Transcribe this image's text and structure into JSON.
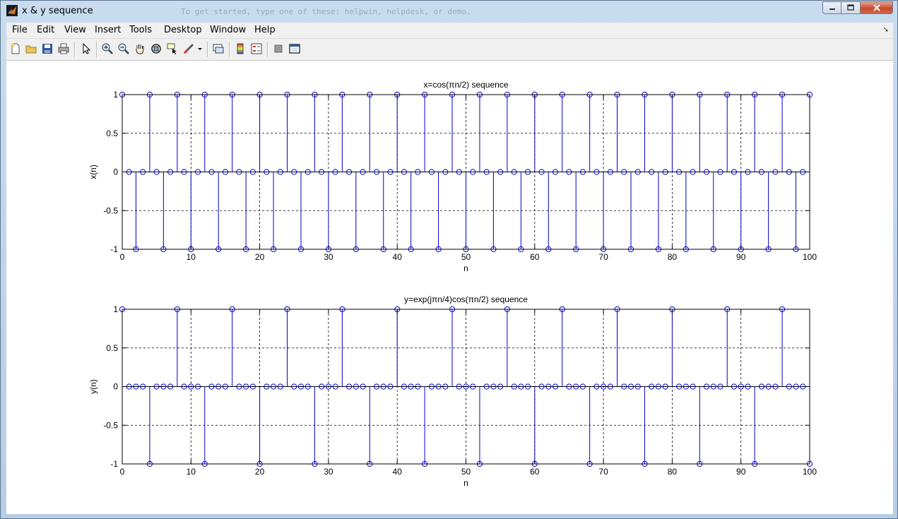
{
  "window": {
    "title": "x & y sequence",
    "command_hint": "To get started, type one of these: helpwin, helpdesk, or demo."
  },
  "menu": [
    "File",
    "Edit",
    "View",
    "Insert",
    "Tools",
    "Desktop",
    "Window",
    "Help"
  ],
  "toolbar_icons": [
    "new-figure-icon",
    "open-file-icon",
    "save-icon",
    "print-icon",
    "pointer-icon",
    "zoom-in-icon",
    "zoom-out-icon",
    "pan-icon",
    "rotate-3d-icon",
    "data-cursor-icon",
    "brush-icon",
    "brush-dropdown-icon",
    "link-plot-icon",
    "colorbar-icon",
    "legend-icon",
    "hide-plot-tools-icon",
    "show-plot-tools-icon"
  ],
  "colors": {
    "stem": "#0000cc",
    "axes": "#000000",
    "grid": "#000000"
  },
  "chart_data": [
    {
      "type": "stem",
      "title": "x=cos(πn/2) sequence",
      "xlabel": "n",
      "ylabel": "x(n)",
      "xlim": [
        0,
        100
      ],
      "ylim": [
        -1,
        1
      ],
      "xticks": [
        "0",
        "10",
        "20",
        "30",
        "40",
        "50",
        "60",
        "70",
        "80",
        "90",
        "100"
      ],
      "yticks": [
        "-1",
        "-0.5",
        "0",
        "0.5",
        "1"
      ],
      "grid": true,
      "n": [
        0,
        1,
        2,
        3,
        4,
        5,
        6,
        7,
        8,
        9,
        10,
        11,
        12,
        13,
        14,
        15,
        16,
        17,
        18,
        19,
        20,
        21,
        22,
        23,
        24,
        25,
        26,
        27,
        28,
        29,
        30,
        31,
        32,
        33,
        34,
        35,
        36,
        37,
        38,
        39,
        40,
        41,
        42,
        43,
        44,
        45,
        46,
        47,
        48,
        49,
        50,
        51,
        52,
        53,
        54,
        55,
        56,
        57,
        58,
        59,
        60,
        61,
        62,
        63,
        64,
        65,
        66,
        67,
        68,
        69,
        70,
        71,
        72,
        73,
        74,
        75,
        76,
        77,
        78,
        79,
        80,
        81,
        82,
        83,
        84,
        85,
        86,
        87,
        88,
        89,
        90,
        91,
        92,
        93,
        94,
        95,
        96,
        97,
        98,
        99,
        100
      ],
      "values": [
        1,
        0,
        -1,
        0,
        1,
        0,
        -1,
        0,
        1,
        0,
        -1,
        0,
        1,
        0,
        -1,
        0,
        1,
        0,
        -1,
        0,
        1,
        0,
        -1,
        0,
        1,
        0,
        -1,
        0,
        1,
        0,
        -1,
        0,
        1,
        0,
        -1,
        0,
        1,
        0,
        -1,
        0,
        1,
        0,
        -1,
        0,
        1,
        0,
        -1,
        0,
        1,
        0,
        -1,
        0,
        1,
        0,
        -1,
        0,
        1,
        0,
        -1,
        0,
        1,
        0,
        -1,
        0,
        1,
        0,
        -1,
        0,
        1,
        0,
        -1,
        0,
        1,
        0,
        -1,
        0,
        1,
        0,
        -1,
        0,
        1,
        0,
        -1,
        0,
        1,
        0,
        -1,
        0,
        1,
        0,
        -1,
        0,
        1,
        0,
        -1,
        0,
        1,
        0,
        -1,
        0,
        1
      ]
    },
    {
      "type": "stem",
      "title": "y=exp(jπn/4)cos(πn/2) sequence",
      "xlabel": "n",
      "ylabel": "y(n)",
      "xlim": [
        0,
        100
      ],
      "ylim": [
        -1,
        1
      ],
      "xticks": [
        "0",
        "10",
        "20",
        "30",
        "40",
        "50",
        "60",
        "70",
        "80",
        "90",
        "100"
      ],
      "yticks": [
        "-1",
        "-0.5",
        "0",
        "0.5",
        "1"
      ],
      "grid": true,
      "n": [
        0,
        1,
        2,
        3,
        4,
        5,
        6,
        7,
        8,
        9,
        10,
        11,
        12,
        13,
        14,
        15,
        16,
        17,
        18,
        19,
        20,
        21,
        22,
        23,
        24,
        25,
        26,
        27,
        28,
        29,
        30,
        31,
        32,
        33,
        34,
        35,
        36,
        37,
        38,
        39,
        40,
        41,
        42,
        43,
        44,
        45,
        46,
        47,
        48,
        49,
        50,
        51,
        52,
        53,
        54,
        55,
        56,
        57,
        58,
        59,
        60,
        61,
        62,
        63,
        64,
        65,
        66,
        67,
        68,
        69,
        70,
        71,
        72,
        73,
        74,
        75,
        76,
        77,
        78,
        79,
        80,
        81,
        82,
        83,
        84,
        85,
        86,
        87,
        88,
        89,
        90,
        91,
        92,
        93,
        94,
        95,
        96,
        97,
        98,
        99,
        100
      ],
      "values": [
        1,
        0,
        0,
        0,
        -1,
        0,
        0,
        0,
        1,
        0,
        0,
        0,
        -1,
        0,
        0,
        0,
        1,
        0,
        0,
        0,
        -1,
        0,
        0,
        0,
        1,
        0,
        0,
        0,
        -1,
        0,
        0,
        0,
        1,
        0,
        0,
        0,
        -1,
        0,
        0,
        0,
        1,
        0,
        0,
        0,
        -1,
        0,
        0,
        0,
        1,
        0,
        0,
        0,
        -1,
        0,
        0,
        0,
        1,
        0,
        0,
        0,
        -1,
        0,
        0,
        0,
        1,
        0,
        0,
        0,
        -1,
        0,
        0,
        0,
        1,
        0,
        0,
        0,
        -1,
        0,
        0,
        0,
        1,
        0,
        0,
        0,
        -1,
        0,
        0,
        0,
        1,
        0,
        0,
        0,
        -1,
        0,
        0,
        0,
        1,
        0,
        0,
        0,
        -1
      ]
    }
  ]
}
